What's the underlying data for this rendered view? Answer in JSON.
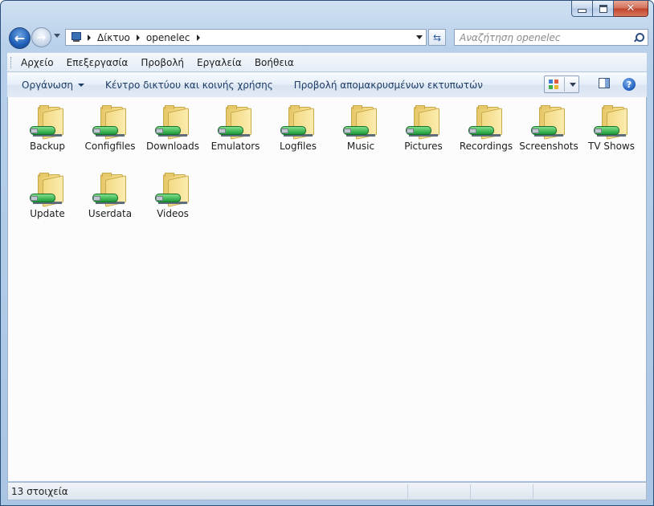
{
  "address": {
    "crumbs": [
      "Δίκτυο",
      "openelec"
    ]
  },
  "search": {
    "placeholder": "Αναζήτηση openelec"
  },
  "menu": [
    "Αρχείο",
    "Επεξεργασία",
    "Προβολή",
    "Εργαλεία",
    "Βοήθεια"
  ],
  "commands": {
    "organize": "Οργάνωση",
    "network_center": "Κέντρο δικτύου και κοινής χρήσης",
    "remote_printers": "Προβολή απομακρυσμένων εκτυπωτών"
  },
  "folders": [
    "Backup",
    "Configfiles",
    "Downloads",
    "Emulators",
    "Logfiles",
    "Music",
    "Pictures",
    "Recordings",
    "Screenshots",
    "TV Shows",
    "Update",
    "Userdata",
    "Videos"
  ],
  "status": {
    "count_text": "13 στοιχεία"
  },
  "icons": {
    "back": "back-arrow-icon",
    "forward": "forward-arrow-icon",
    "refresh": "refresh-icon",
    "search": "search-icon",
    "help": "help-icon",
    "folder": "network-folder-icon"
  },
  "colors": {
    "frame": "#b8d0ea",
    "close_button": "#c0412a",
    "content_bg": "#fcfcfc",
    "command_text": "#1e3c64"
  }
}
